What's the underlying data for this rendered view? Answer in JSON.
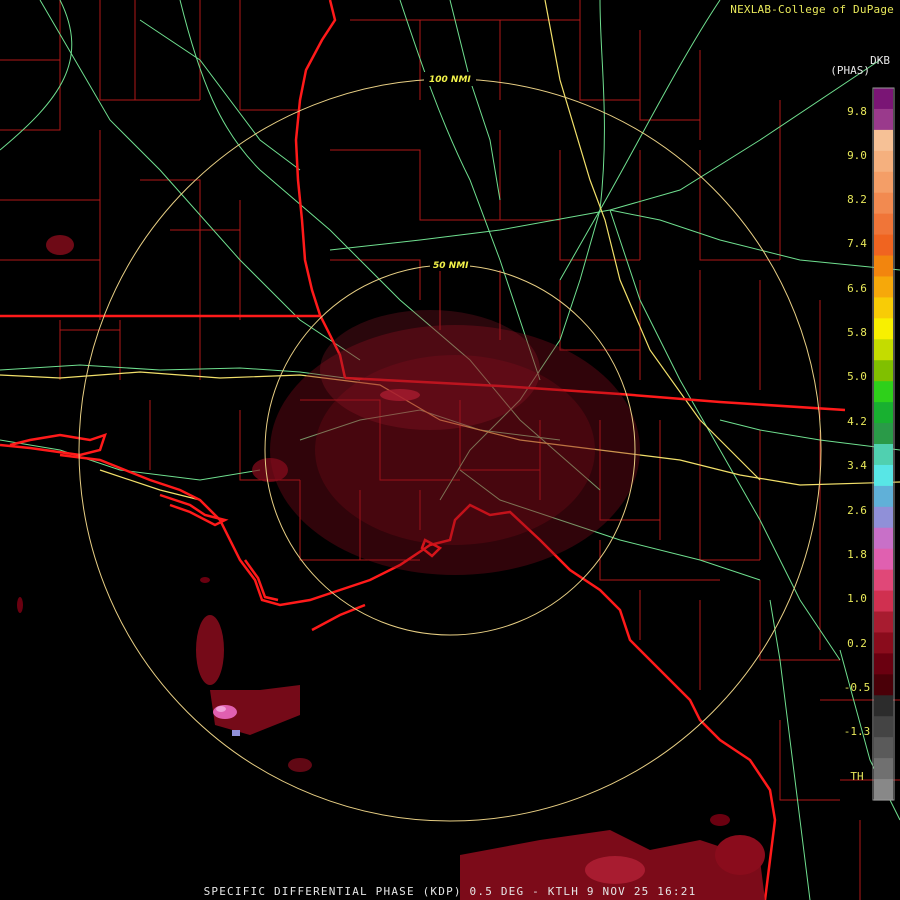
{
  "credit": "NEXLAB-College of DuPage",
  "units_abbr": "DKB",
  "units": "(PHAS)",
  "caption": "SPECIFIC DIFFERENTIAL PHASE (KDP) 0.5 DEG - KTLH 9 NOV 25 16:21",
  "range_rings": [
    {
      "label": "100 NMI"
    },
    {
      "label": "50 NMI"
    }
  ],
  "scale": {
    "ticks": [
      "9.8",
      "9.0",
      "8.2",
      "7.4",
      "6.6",
      "5.8",
      "5.0",
      "4.2",
      "3.4",
      "2.6",
      "1.8",
      "1.0",
      "0.2",
      "-0.5",
      "-1.3",
      "TH"
    ],
    "colors": [
      "#7a1575",
      "#9a3a8c",
      "#f6c196",
      "#f5b07e",
      "#f49e67",
      "#f28a50",
      "#f07538",
      "#f06420",
      "#f2850e",
      "#f6a80a",
      "#f8cc06",
      "#f8f000",
      "#c4dc00",
      "#80c000",
      "#2ed01a",
      "#18b030",
      "#2a9a48",
      "#50d0b0",
      "#58e6e6",
      "#60b0d8",
      "#9090d8",
      "#c870c8",
      "#e060b0",
      "#e04878",
      "#d03050",
      "#a81c30",
      "#8a0c1c",
      "#6a0010",
      "#4a0008",
      "#2c2c2c",
      "#444444",
      "#5a5a5a",
      "#707070",
      "#888888"
    ]
  },
  "colors": {
    "state_border": "#ff1a1a",
    "county_line": "#b01818",
    "highway": "#6fdf8f",
    "interstate": "#f2e06a",
    "range_ring": "#e8cf84",
    "echo": "#8a0c1c"
  }
}
